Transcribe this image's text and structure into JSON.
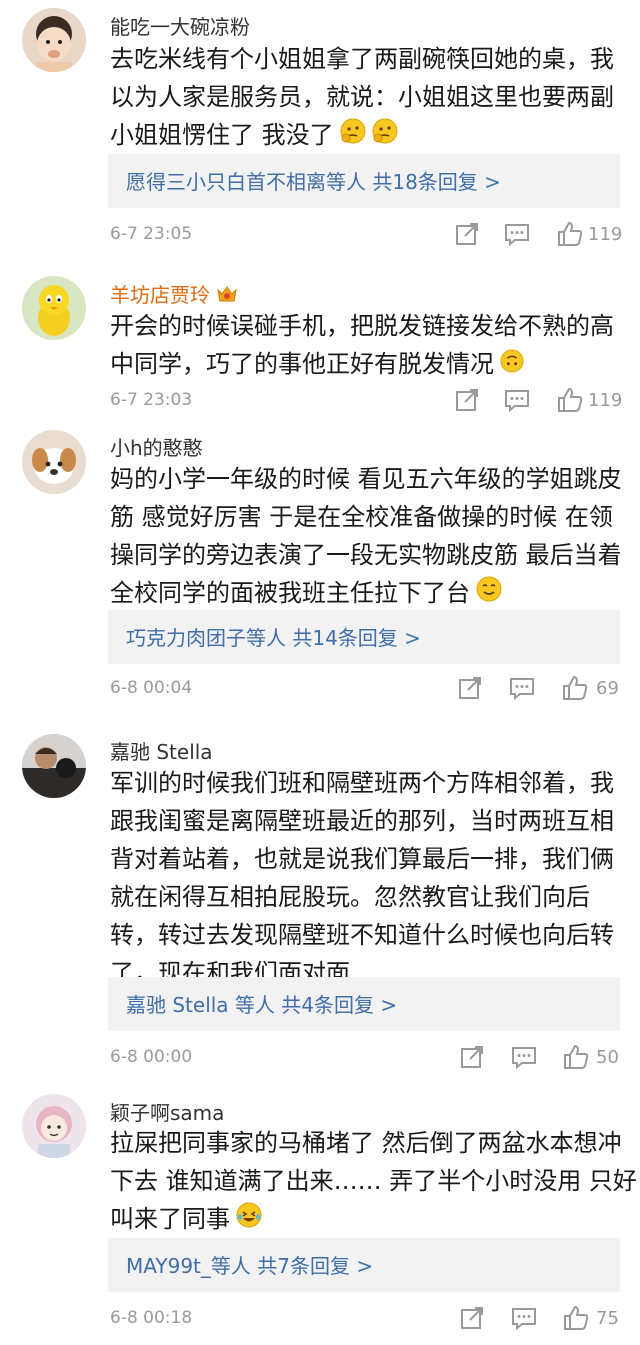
{
  "comments": [
    {
      "user": "能吃一大碗凉粉",
      "lines": [
        "去吃米线有个小姐姐拿了两副碗筷回她的桌，我",
        "以为人家是服务员，就说：小姐姐这里也要两副",
        "小姐姐愣住了 我没了"
      ],
      "reply": "愿得三小只白首不相离等人 共18条回复 >",
      "time": "6-7 23:05",
      "likes": "119",
      "emoji": "thinking-emoji"
    },
    {
      "user": "羊坊店贾玲",
      "lines": [
        "开会的时候误碰手机，把脱发链接发给不熟的高",
        "中同学，巧了的事他正好有脱发情况"
      ],
      "time": "6-7 23:03",
      "likes": "119",
      "emoji": "upside-down-emoji"
    },
    {
      "user": "小h的憨憨",
      "lines": [
        "妈的小学一年级的时候 看见五六年级的学姐跳皮",
        "筋 感觉好厉害 于是在全校准备做操的时候 在领",
        "操同学的旁边表演了一段无实物跳皮筋 最后当着",
        "全校同学的面被我班主任拉下了台"
      ],
      "reply": "巧克力肉团子等人 共14条回复 >",
      "time": "6-8 00:04",
      "likes": "69",
      "emoji": "smile-emoji"
    },
    {
      "user": "嘉驰 Stella",
      "lines": [
        "军训的时候我们班和隔壁班两个方阵相邻着，我",
        "跟我闺蜜是离隔壁班最近的那列，当时两班互相",
        "背对着站着，也就是说我们算最后一排，我们俩",
        "就在闲得互相拍屁股玩。忽然教官让我们向后",
        "转，转过去发现隔壁班不知道什么时候也向后转",
        "了，现在和我们面对面……"
      ],
      "reply": "嘉驰 Stella 等人 共4条回复 >",
      "time": "6-8 00:00",
      "likes": "50"
    },
    {
      "user": "颖子啊sama",
      "lines": [
        "拉屎把同事家的马桶堵了 然后倒了两盆水本想冲",
        "下去 谁知道满了出来…… 弄了半个小时没用 只好",
        "叫来了同事"
      ],
      "reply": "MAY99t_等人 共7条回复 >",
      "time": "6-8 00:18",
      "likes": "75",
      "emoji": "laughing-tears-emoji"
    }
  ],
  "icons": {
    "share": "share-icon",
    "comment": "comment-icon",
    "like": "thumbs-up-icon"
  },
  "colors": {
    "link": "#3f6ea8",
    "vip_name": "#e06a10",
    "meta": "#9a9a9a",
    "reply_bg": "#f2f2f2"
  }
}
